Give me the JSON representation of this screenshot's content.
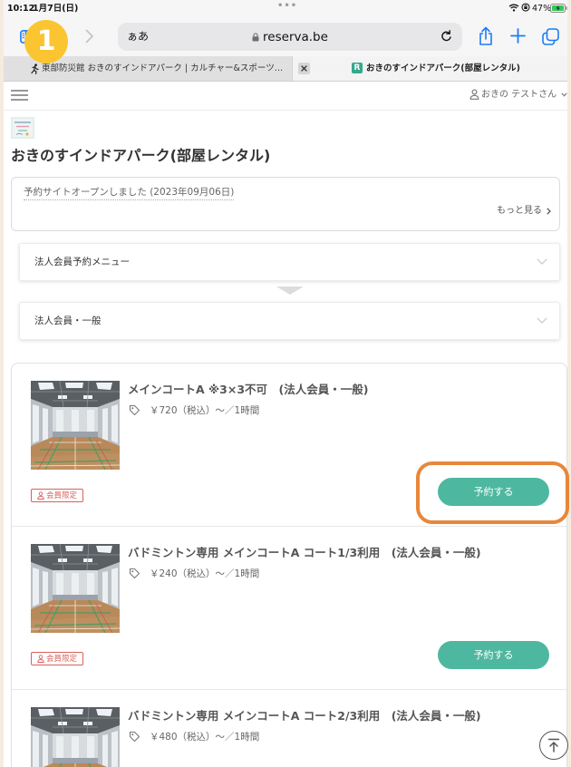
{
  "status_bar": {
    "time": "10:12",
    "date": "1月7日(日)",
    "multitask_dots": "•••",
    "battery": "47%",
    "icons": [
      "wifi-icon",
      "orientation-lock-icon",
      "battery-charging-icon"
    ]
  },
  "browser": {
    "reader_label": "ぁあ",
    "url": "reserva.be",
    "tabs": [
      {
        "title": "東部防災館 おきのすインドアパーク | カルチャー&スポーツ…",
        "active": false,
        "favicon": "runner-icon"
      },
      {
        "title": "おきのすインドアパーク(部屋レンタル)",
        "active": true,
        "favicon_letter": "R"
      }
    ],
    "icons": [
      "sidebar-icon",
      "back-icon",
      "forward-icon",
      "lock-icon",
      "reload-icon",
      "share-icon",
      "new-tab-icon",
      "tabs-overview-icon"
    ]
  },
  "annotation": {
    "step": "1",
    "step_color": "#fbc531",
    "highlight_color": "#e8873a"
  },
  "site": {
    "user_name": "おきの テストさん",
    "page_title": "おきのすインドアパーク(部屋レンタル)",
    "notice": {
      "text": "予約サイトオープンしました (2023年09月06日)",
      "more_label": "もっと見る"
    },
    "menus": [
      {
        "label": "法人会員予約メニュー",
        "expanded": false
      },
      {
        "label": "法人会員・一般",
        "expanded": false
      }
    ],
    "accent_color": "#4db89f",
    "badge_color": "#d9615b",
    "plans": [
      {
        "title": "メインコートA ※3×3不可　(法人会員・一般)",
        "price": "￥720（税込）〜／1時間",
        "badge": "会員限定",
        "button": "予約する"
      },
      {
        "title": "バドミントン専用 メインコートA コート1/3利用　(法人会員・一般)",
        "price": "￥240（税込）〜／1時間",
        "badge": "会員限定",
        "button": "予約する"
      },
      {
        "title": "バドミントン専用 メインコートA コート2/3利用　(法人会員・一般)",
        "price": "￥480（税込）〜／1時間"
      }
    ]
  }
}
